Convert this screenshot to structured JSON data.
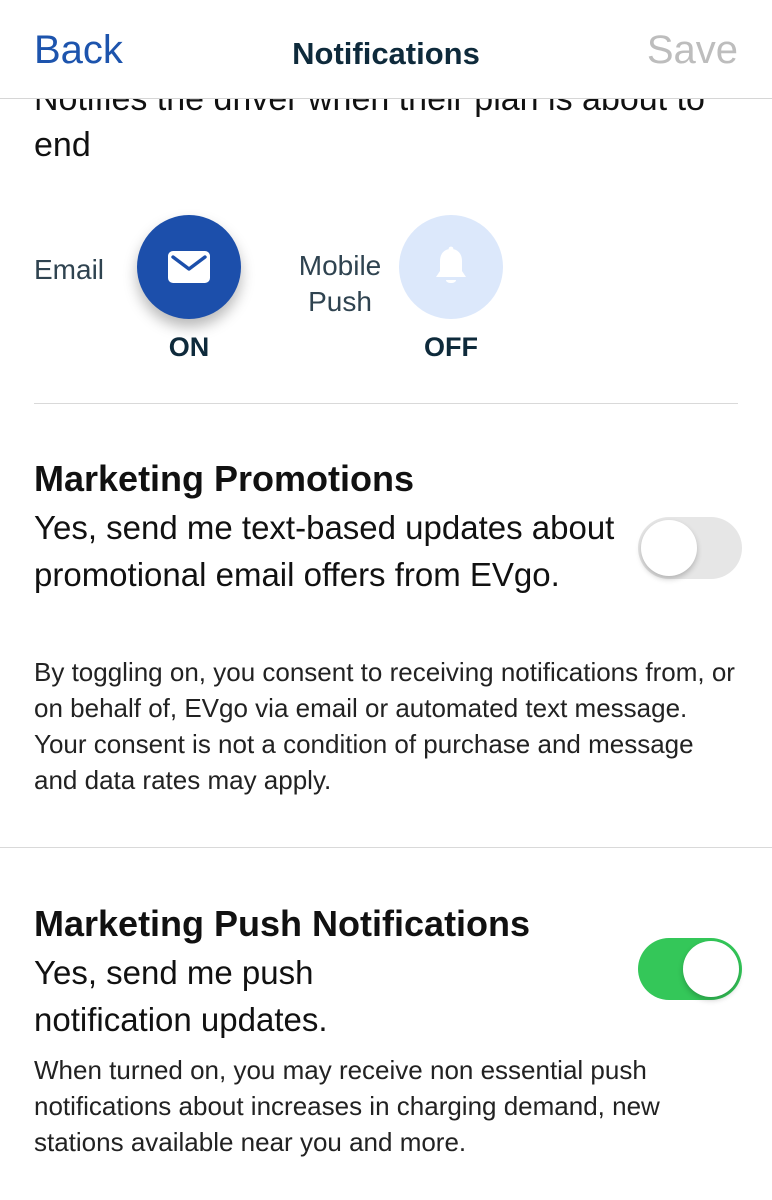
{
  "header": {
    "back_label": "Back",
    "title": "Notifications",
    "save_label": "Save"
  },
  "plan_end": {
    "description": "Notifies the driver when their plan is about to end",
    "channels": [
      {
        "label": "Email",
        "icon": "mail-icon",
        "state": "ON"
      },
      {
        "label": "Mobile Push",
        "icon": "bell-icon",
        "state": "OFF"
      }
    ]
  },
  "marketing_promotions": {
    "title": "Marketing Promotions",
    "description": "Yes, send me text-based updates about promotional email offers from EVgo.",
    "note": "By toggling on, you consent to receiving notifications from, or on behalf of, EVgo via email or automated text message. Your consent is not a condition of purchase and message and data rates may apply.",
    "enabled": false
  },
  "marketing_push": {
    "title": "Marketing Push Notifications",
    "description": "Yes, send me push notification updates.",
    "note": "When turned on, you may receive non essential push notifications about increases in charging demand, new stations available near you and more.",
    "enabled": true
  },
  "colors": {
    "accent_blue": "#1c4fab",
    "back_link": "#1d54ad",
    "toggle_on": "#34c759",
    "toggle_off": "#e6e6e6",
    "inactive_circle": "#dce8fb"
  }
}
